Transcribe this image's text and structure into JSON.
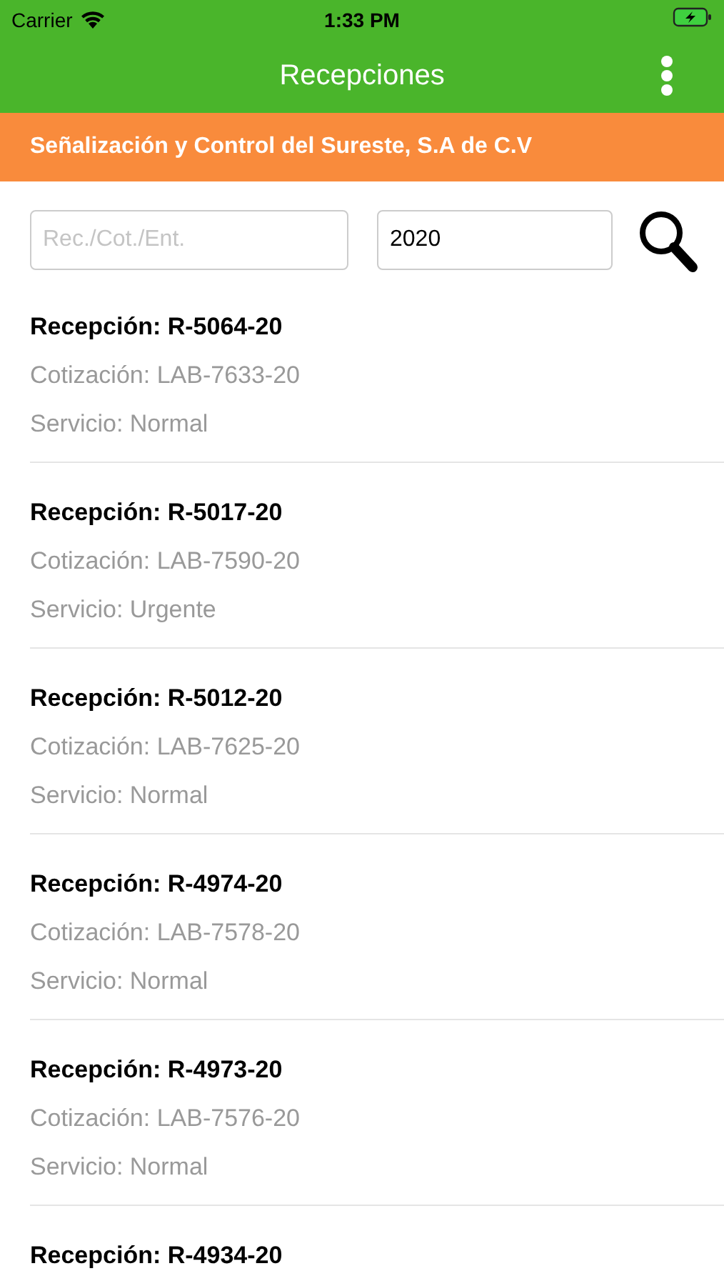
{
  "status_bar": {
    "carrier": "Carrier",
    "time": "1:33 PM"
  },
  "nav": {
    "title": "Recepciones"
  },
  "company": "Señalización y Control del Sureste, S.A de C.V",
  "search": {
    "placeholder": "Rec./Cot./Ent.",
    "year": "2020"
  },
  "items": [
    {
      "reception": "Recepción: R-5064-20",
      "quote": "Cotización: LAB-7633-20",
      "service": "Servicio: Normal"
    },
    {
      "reception": "Recepción: R-5017-20",
      "quote": "Cotización: LAB-7590-20",
      "service": "Servicio: Urgente"
    },
    {
      "reception": "Recepción: R-5012-20",
      "quote": "Cotización: LAB-7625-20",
      "service": "Servicio: Normal"
    },
    {
      "reception": "Recepción: R-4974-20",
      "quote": "Cotización: LAB-7578-20",
      "service": "Servicio: Normal"
    },
    {
      "reception": "Recepción: R-4973-20",
      "quote": "Cotización: LAB-7576-20",
      "service": "Servicio: Normal"
    },
    {
      "reception": "Recepción: R-4934-20"
    }
  ]
}
